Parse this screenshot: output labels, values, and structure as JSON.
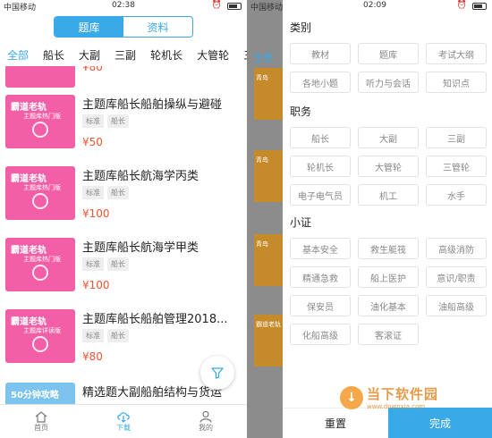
{
  "left": {
    "status": {
      "carrier": "中国移动",
      "time": "02:38"
    },
    "segment": {
      "tab1": "题库",
      "tab2": "资料"
    },
    "categories": [
      "全部",
      "船长",
      "大副",
      "三副",
      "轮机长",
      "大管轮",
      "三管"
    ],
    "items": [
      {
        "price": "¥80"
      },
      {
        "title": "主题库船长船舶操纵与避碰",
        "tags": [
          "标准",
          "船长"
        ],
        "price": "¥50",
        "thumb_title": "霸道老轨",
        "thumb_sub": "主题库热门版"
      },
      {
        "title": "主题库船长航海学丙类",
        "tags": [
          "标准",
          "船长"
        ],
        "price": "¥100",
        "thumb_title": "霸道老轨",
        "thumb_sub": "主题库热门版"
      },
      {
        "title": "主题库船长航海学甲类",
        "tags": [
          "标准",
          "船长"
        ],
        "price": "¥100",
        "thumb_title": "霸道老轨",
        "thumb_sub": "主题库热门版"
      },
      {
        "title": "主题库船长船舶管理2018...",
        "tags": [
          "标准",
          "船长"
        ],
        "price": "¥80",
        "thumb_title": "霸道老轨",
        "thumb_sub": "主题库详读版"
      },
      {
        "title": "精选题大副船舶结构与货运",
        "thumb_title": "50分钟攻略"
      }
    ],
    "tabbar": {
      "home": "首页",
      "download": "下载",
      "mine": "我的"
    }
  },
  "right": {
    "status": {
      "carrier": "中国移动",
      "time": "02:09"
    },
    "behind_label": "全部",
    "behind_thumbs": [
      "青岛",
      "青岛",
      "青岛",
      "霸道老轨"
    ],
    "sections": [
      {
        "title": "类别",
        "chips": [
          "教材",
          "题库",
          "考试大纲",
          "各地小题",
          "听力与会话",
          "知识点"
        ]
      },
      {
        "title": "职务",
        "chips": [
          "船长",
          "大副",
          "三副",
          "轮机长",
          "大管轮",
          "三管轮",
          "电子电气员",
          "机工",
          "水手"
        ]
      },
      {
        "title": "小证",
        "chips": [
          "基本安全",
          "救生艇筏",
          "高级消防",
          "精通急救",
          "船上医护",
          "意识/职责",
          "保安员",
          "油化基本",
          "油船高级",
          "化船高级",
          "客滚证"
        ]
      }
    ],
    "reset_label": "重置",
    "done_label": "完成"
  },
  "watermark": {
    "cn": "当下软件园",
    "en": "www.downxia.com"
  },
  "colors": {
    "accent": "#3aa9e8",
    "price": "#f0532f",
    "thumb": "#f35fa6"
  }
}
